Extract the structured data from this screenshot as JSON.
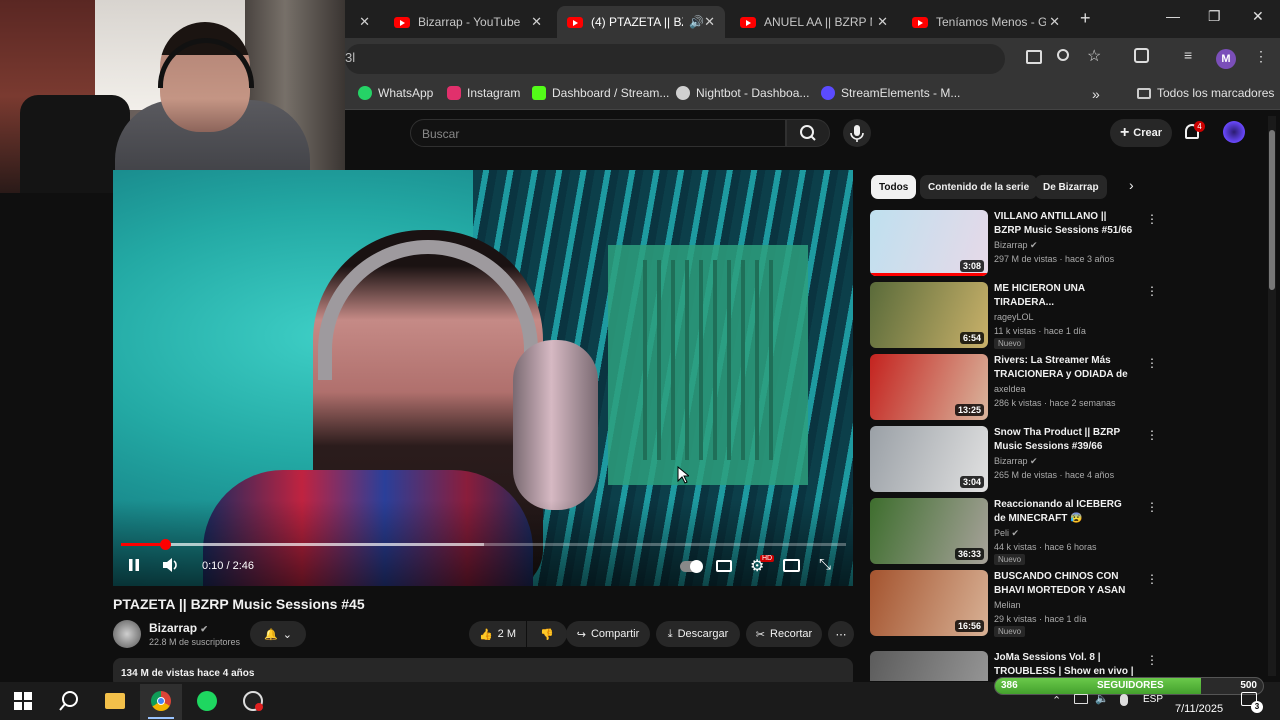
{
  "browser": {
    "tabs": [
      {
        "title": "Bizarrap - YouTube",
        "active": false
      },
      {
        "title": "(4) PTAZETA || BZRP",
        "active": true,
        "audio": true
      },
      {
        "title": "ANUEL AA || BZRP M",
        "active": false
      },
      {
        "title": "Teníamos Menos - G",
        "active": false
      }
    ],
    "new_tab": "+",
    "window_controls": {
      "minimize": "—",
      "maximize": "❐",
      "close": "✕"
    },
    "address_fragment": "3l",
    "profile_initial": "M",
    "bookmarks": [
      {
        "label": "WhatsApp",
        "color": "#25d366"
      },
      {
        "label": "Instagram",
        "color": "#e1306c"
      },
      {
        "label": "Dashboard / Stream...",
        "color": "#53fc18"
      },
      {
        "label": "Nightbot - Dashboa...",
        "color": "#d0d0d0"
      },
      {
        "label": "StreamElements - M...",
        "color": "#5b4bff"
      }
    ],
    "bookmarks_overflow": "»",
    "all_bookmarks": "Todos los marcadores"
  },
  "youtube": {
    "search_placeholder": "Buscar",
    "create_label": "Crear",
    "notification_count": "4",
    "player": {
      "time": "0:10 / 2:46",
      "progress": 0.06,
      "buffered": 0.5,
      "settings_badge": "HD"
    },
    "video": {
      "title": "PTAZETA || BZRP Music Sessions #45",
      "channel": "Bizarrap",
      "subscribers": "22.8 M de suscriptores",
      "likes": "2 M",
      "share": "Compartir",
      "download": "Descargar",
      "clip": "Recortar",
      "views_line": "134 M de vistas  hace 4 años"
    },
    "chips": [
      {
        "label": "Todos",
        "selected": true
      },
      {
        "label": "Contenido de la serie",
        "selected": false
      },
      {
        "label": "De Bizarrap",
        "selected": false
      }
    ],
    "recommendations": [
      {
        "title": "VILLANO ANTILLANO || BZRP Music Sessions #51/66",
        "channel": "Bizarrap",
        "verified": true,
        "meta": "297 M de vistas · hace 3 años",
        "duration": "3:08",
        "badge": "",
        "thumb": [
          "#bfe0ef",
          "#e7d9e8"
        ]
      },
      {
        "title": "ME HICIERON UNA TIRADERA...",
        "channel": "rageyLOL",
        "verified": false,
        "meta": "11 k vistas · hace 1 día",
        "duration": "6:54",
        "badge": "Nuevo",
        "thumb": [
          "#5a6b3a",
          "#c9b16a"
        ]
      },
      {
        "title": "Rivers: La Streamer Más TRAICIONERA y ODIADA de ...",
        "channel": "axeldea",
        "verified": false,
        "meta": "286 k vistas · hace 2 semanas",
        "duration": "13:25",
        "badge": "",
        "thumb": [
          "#c4231f",
          "#d9b59d"
        ]
      },
      {
        "title": "Snow Tha Product || BZRP Music Sessions #39/66",
        "channel": "Bizarrap",
        "verified": true,
        "meta": "265 M de vistas · hace 4 años",
        "duration": "3:04",
        "badge": "",
        "thumb": [
          "#9aa0a6",
          "#e1e1e1"
        ]
      },
      {
        "title": "Reaccionando al ICEBERG de MINECRAFT 😰",
        "channel": "Peli",
        "verified": true,
        "meta": "44 k vistas · hace 6 horas",
        "duration": "36:33",
        "badge": "Nuevo",
        "thumb": [
          "#3e6e2e",
          "#a7a29a"
        ]
      },
      {
        "title": "BUSCANDO CHINOS CON BHAVI MORTEDOR Y ASAN en...",
        "channel": "Melian",
        "verified": false,
        "meta": "29 k vistas · hace 1 día",
        "duration": "16:56",
        "badge": "Nuevo",
        "thumb": [
          "#a4542f",
          "#d8b195"
        ]
      },
      {
        "title": "JoMa Sessions Vol. 8 | TROUBLESS | Show en vivo | 2...",
        "channel": "",
        "verified": false,
        "meta": "",
        "duration": "",
        "badge": "",
        "thumb": [
          "#5c5c5c",
          "#9a9a9a"
        ]
      }
    ]
  },
  "overlay": {
    "followers_label": "SEGUIDORES",
    "followers_current": "386",
    "followers_goal": "500",
    "followers_fraction": 0.77
  },
  "taskbar": {
    "language": "ESP",
    "date": "7/11/2025",
    "notifications": "3",
    "apps": [
      "windows-icon",
      "search-icon",
      "explorer-icon",
      "chrome-icon",
      "spotify-icon",
      "obs-icon"
    ]
  }
}
